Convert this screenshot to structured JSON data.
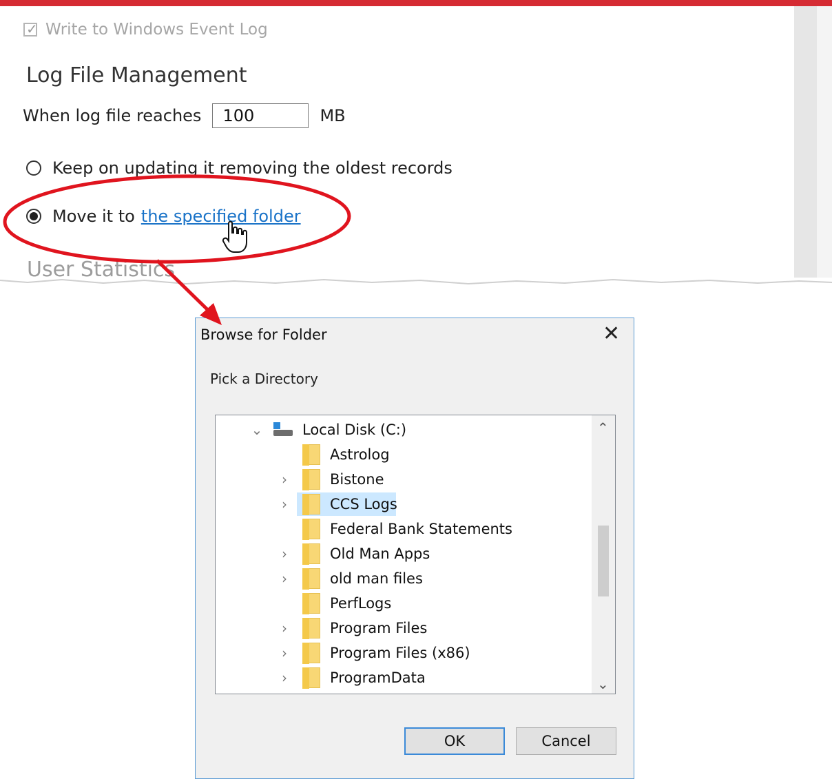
{
  "settings": {
    "event_log_label": "Write to Windows Event Log",
    "event_log_checked": true,
    "section_heading": "Log File Management",
    "size_prefix": "When log file reaches",
    "size_value": "100",
    "size_unit": "MB",
    "option_keep": "Keep on updating it removing the oldest records",
    "option_move_prefix": "Move it to",
    "option_move_link": "the specified folder",
    "next_section": "User Statistics"
  },
  "dialog": {
    "title": "Browse for Folder",
    "close_glyph": "✕",
    "prompt": "Pick a Directory",
    "tree": {
      "root": {
        "label": "Local Disk (C:)",
        "expanded": true
      },
      "items": [
        {
          "label": "Astrolog",
          "has_children": false,
          "selected": false
        },
        {
          "label": "Bistone",
          "has_children": true,
          "selected": false
        },
        {
          "label": "CCS Logs",
          "has_children": true,
          "selected": true
        },
        {
          "label": "Federal Bank Statements",
          "has_children": false,
          "selected": false
        },
        {
          "label": "Old Man Apps",
          "has_children": true,
          "selected": false
        },
        {
          "label": "old man files",
          "has_children": true,
          "selected": false
        },
        {
          "label": "PerfLogs",
          "has_children": false,
          "selected": false
        },
        {
          "label": "Program Files",
          "has_children": true,
          "selected": false
        },
        {
          "label": "Program Files (x86)",
          "has_children": true,
          "selected": false
        },
        {
          "label": "ProgramData",
          "has_children": true,
          "selected": false
        }
      ]
    },
    "ok_label": "OK",
    "cancel_label": "Cancel"
  },
  "colors": {
    "accent_bar": "#d52b33",
    "annotation": "#e0141e",
    "link": "#1a73c8",
    "selection": "#cce8ff"
  }
}
